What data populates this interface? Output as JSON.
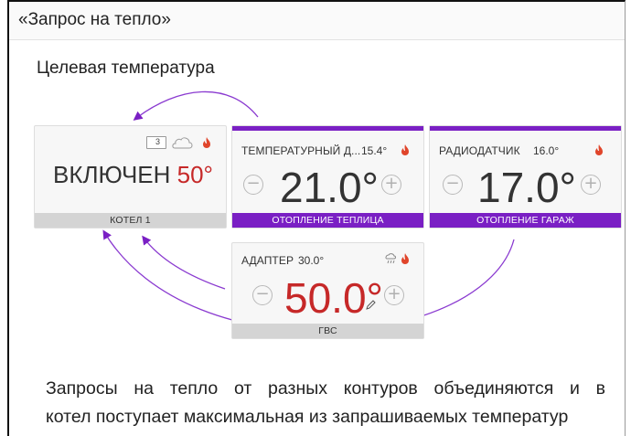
{
  "header": {
    "title": "«Запрос на тепло»"
  },
  "section": {
    "title": "Целевая температура"
  },
  "boiler": {
    "queue_badge": "3",
    "state_label": "ВКЛЮЧЕН",
    "temperature": "50°",
    "footer": "КОТЕЛ 1"
  },
  "cards": [
    {
      "sensor_name": "ТЕМПЕРАТУРНЫЙ Д...",
      "sensor_value": "15.4°",
      "target": "21.0°",
      "minus": "−",
      "plus": "+",
      "footer": "ОТОПЛЕНИЕ ТЕПЛИЦА"
    },
    {
      "sensor_name": "РАДИОДАТЧИК",
      "sensor_value": "16.0°",
      "target": "17.0°",
      "minus": "−",
      "plus": "+",
      "footer": "ОТОПЛЕНИЕ ГАРАЖ"
    },
    {
      "sensor_name": "АДАПТЕР",
      "sensor_value": "30.0°",
      "target": "50.0°",
      "minus": "−",
      "plus": "+",
      "footer": "ГВС"
    }
  ],
  "description": {
    "line1": "Запросы на тепло от разных контуров объединяются и в",
    "line2": "котел поступает максимальная из запрашиваемых температур"
  },
  "colors": {
    "accent": "#7a1fc4",
    "flame": "#e0452b",
    "hot": "#c62828"
  },
  "icons": [
    "queue-icon",
    "cloud-icon",
    "flame-icon",
    "weather-icon",
    "pencil-icon",
    "minus-icon",
    "plus-icon"
  ]
}
